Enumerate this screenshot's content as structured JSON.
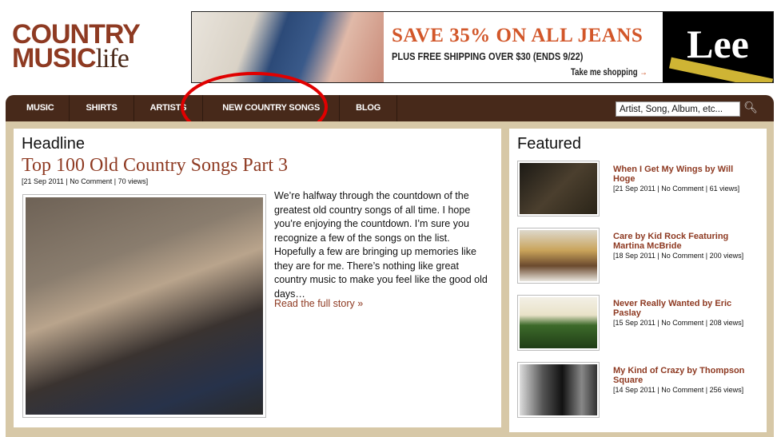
{
  "logo": {
    "line1": "COUNTRY",
    "line2": "MUSIC",
    "line3": "life"
  },
  "ad": {
    "headline": "SAVE 35% ON ALL JEANS",
    "subline": "PLUS FREE SHIPPING OVER $30  (ENDS 9/22)",
    "cta": "Take me shopping",
    "cta_arrow": "→",
    "brand": "Lee"
  },
  "nav": {
    "items": [
      "MUSIC",
      "SHIRTS",
      "ARTISTS",
      "NEW COUNTRY SONGS",
      "BLOG"
    ],
    "search_value": "Artist, Song, Album, etc...",
    "search_icon": "magnifier"
  },
  "main": {
    "heading": "Headline",
    "title": "Top 100 Old Country Songs Part 3",
    "meta": "[21 Sep 2011 | No Comment | 70 views]",
    "excerpt": "We’re halfway through the countdown of the greatest old country songs of all time. I hope you’re enjoying the countdown. I’m sure you recognize a few of the songs on the list. Hopefully a few are bringing up memories like they are for me. There’s nothing like great country music to make you feel like the good old days…",
    "read_more": "Read the full story »"
  },
  "featured": {
    "heading": "Featured",
    "items": [
      {
        "title": "When I Get My Wings by Will Hoge",
        "meta": "[21 Sep 2011 | No Comment | 61 views]"
      },
      {
        "title": "Care by Kid Rock Featuring Martina McBride",
        "meta": "[18 Sep 2011 | No Comment | 200 views]"
      },
      {
        "title": "Never Really Wanted by Eric Paslay",
        "meta": "[15 Sep 2011 | No Comment | 208 views]"
      },
      {
        "title": "My Kind of Crazy by Thompson Square",
        "meta": "[14 Sep 2011 | No Comment | 256 views]"
      }
    ]
  },
  "colors": {
    "brand": "#8e3a22",
    "nav": "#47291a",
    "background": "#d7c8a7",
    "annotation": "#e00000"
  }
}
